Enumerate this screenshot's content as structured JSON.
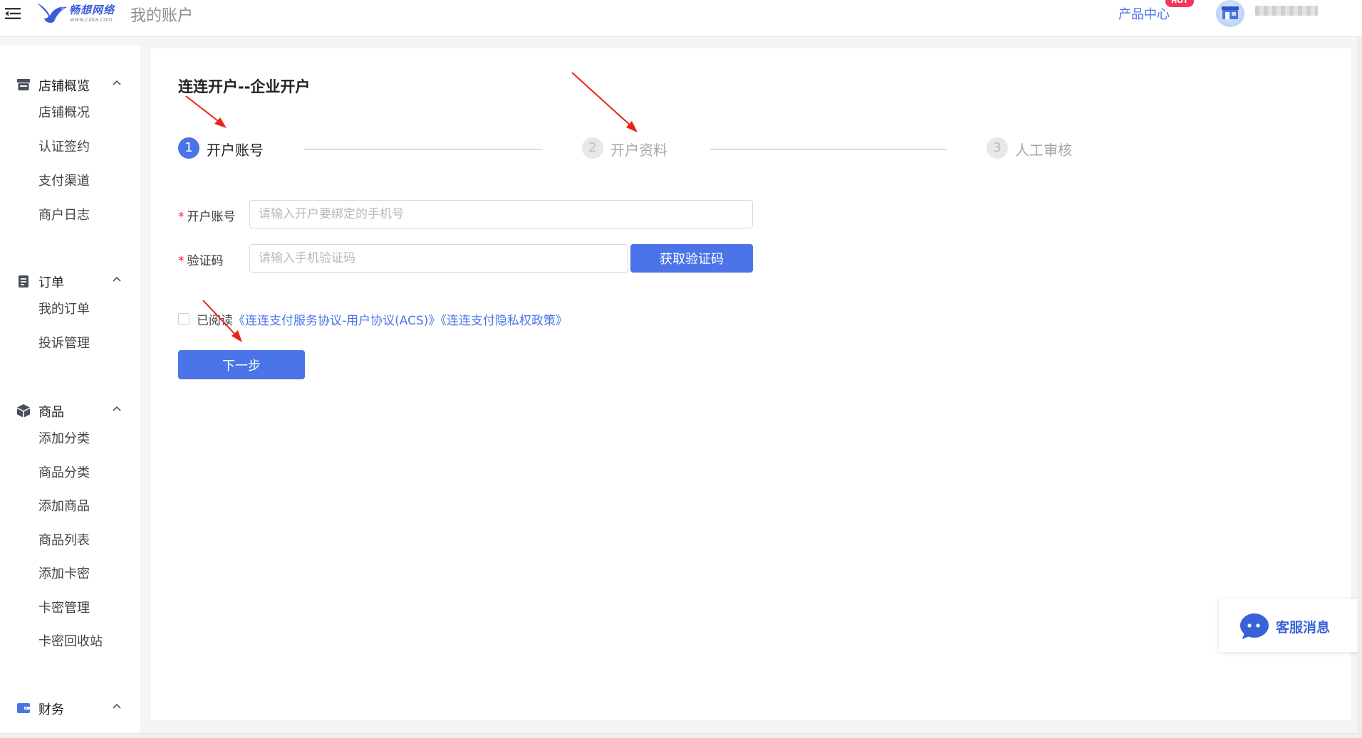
{
  "header": {
    "logo_text": "畅想网络",
    "logo_sub": "www.cxka.com",
    "page_title": "我的账户",
    "product_center": "产品中心",
    "hot_badge": "HOT",
    "username": "username"
  },
  "sidebar": {
    "groups": [
      {
        "label": "店铺概览",
        "icon": "store-icon",
        "items": [
          "店铺概况",
          "认证签约",
          "支付渠道",
          "商户日志"
        ]
      },
      {
        "label": "订单",
        "icon": "clipboard-icon",
        "items": [
          "我的订单",
          "投诉管理"
        ]
      },
      {
        "label": "商品",
        "icon": "box-icon",
        "items": [
          "添加分类",
          "商品分类",
          "添加商品",
          "商品列表",
          "添加卡密",
          "卡密管理",
          "卡密回收站"
        ]
      },
      {
        "label": "财务",
        "icon": "wallet-icon",
        "items": []
      }
    ]
  },
  "form": {
    "title": "连连开户--企业开户",
    "steps": [
      {
        "number": "1",
        "label": "开户账号",
        "state": "active"
      },
      {
        "number": "2",
        "label": "开户资料",
        "state": "inactive"
      },
      {
        "number": "3",
        "label": "人工审核",
        "state": "inactive"
      }
    ],
    "account_field": {
      "label": "开户账号",
      "placeholder": "请输入开户要绑定的手机号",
      "value": ""
    },
    "code_field": {
      "label": "验证码",
      "placeholder": "请输入手机验证码",
      "value": ""
    },
    "get_code_label": "获取验证码",
    "agreement": {
      "prefix": "已阅读",
      "link1": "《连连支付服务协议-用户协议(ACS)》",
      "link2": "《连连支付隐私权政策》",
      "checked": false
    },
    "next_label": "下一步"
  },
  "chat": {
    "label": "客服消息"
  },
  "colors": {
    "primary": "#4a74e8",
    "required": "#f5222d",
    "hot": "#f5365c",
    "annotation": "#e8231a"
  }
}
